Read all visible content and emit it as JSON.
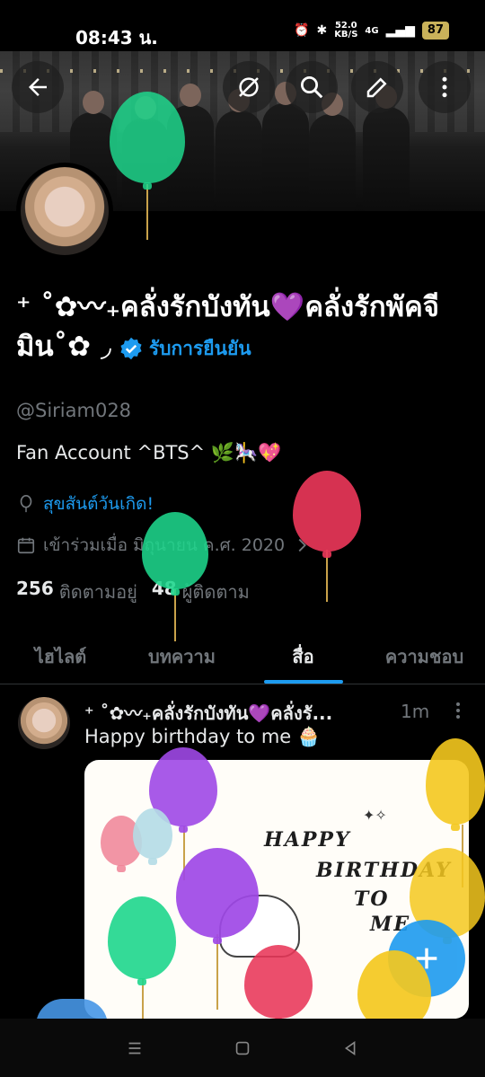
{
  "status_bar": {
    "time": "08:43 น.",
    "speed": "52.0",
    "speed_unit": "KB/S",
    "network": "4G",
    "battery": "87"
  },
  "profile": {
    "display_name": "⁺ ˚✿〰₊คลั่งรักบังทัน💜คลั่งรักพัคจีมิน˚✿ ◞",
    "verified_label": "รับการยืนยัน",
    "handle": "@Siriam028",
    "bio": "Fan Account ^BTS^ 🌿🎠💖",
    "birthday": "สุขสันต์วันเกิด!",
    "joined": "เข้าร่วมเมื่อ มิถุนายน ค.ศ. 2020",
    "following_count": "256",
    "following_label": "ติดตามอยู่",
    "followers_count": "48",
    "followers_label": "ผู้ติดตาม"
  },
  "tabs": [
    {
      "label": "ไฮไลต์"
    },
    {
      "label": "บทความ"
    },
    {
      "label": "สื่อ"
    },
    {
      "label": "ความชอบ"
    }
  ],
  "active_tab": "สื่อ",
  "tweet": {
    "author": "⁺ ˚✿〰₊คลั่งรักบังทัน💜คลั่งรั...",
    "time": "1m",
    "text": "Happy birthday to me 🧁",
    "media_lines": [
      "HAPPY",
      "BIRTHDAY",
      "TO",
      "ME"
    ]
  },
  "icons": [
    "back-arrow-icon",
    "no-grok-icon",
    "search-icon",
    "edit-icon",
    "more-vertical-icon",
    "verified-icon",
    "balloon-icon",
    "calendar-icon",
    "chevron-right-icon",
    "plus-icon"
  ],
  "colors": {
    "accent": "#1d9bf0",
    "background": "#000000",
    "muted": "#71767b"
  }
}
